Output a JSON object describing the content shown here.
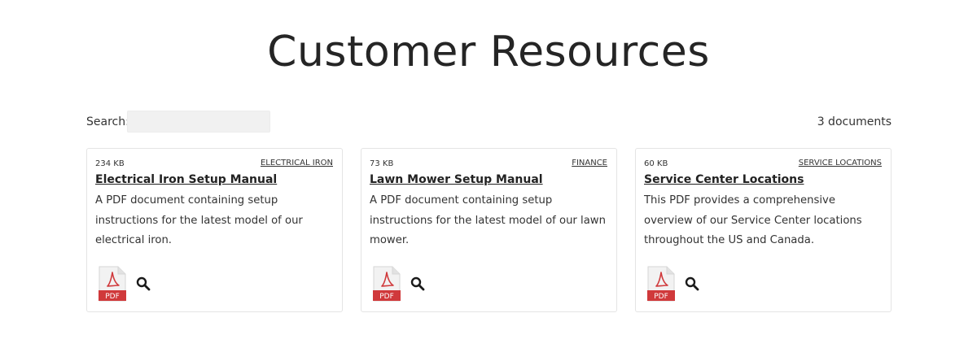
{
  "page": {
    "title": "Customer Resources"
  },
  "search": {
    "label": "Search:",
    "value": "",
    "placeholder": ""
  },
  "document_count": "3 documents",
  "documents": [
    {
      "size": "234 KB",
      "tag": "ELECTRICAL IRON",
      "title": "Electrical Iron Setup Manual",
      "description": "A PDF document containing setup instructions for the latest model of our electrical iron.",
      "file_icon": "pdf-file-icon",
      "file_icon_label": "PDF",
      "action_icon": "magnifier-icon"
    },
    {
      "size": "73 KB",
      "tag": "FINANCE",
      "title": "Lawn Mower Setup Manual",
      "description": "A PDF document containing setup instructions for the latest model of our lawn mower.",
      "file_icon": "pdf-file-icon",
      "file_icon_label": "PDF",
      "action_icon": "magnifier-icon"
    },
    {
      "size": "60 KB",
      "tag": "SERVICE LOCATIONS",
      "title": "Service Center Locations",
      "description": "This PDF provides a comprehensive overview of our Service Center locations throughout the US and Canada.",
      "file_icon": "pdf-file-icon",
      "file_icon_label": "PDF",
      "action_icon": "magnifier-icon"
    }
  ],
  "colors": {
    "pdf_red": "#d0393b",
    "text": "#222222",
    "card_border": "#e4e4e4",
    "search_bg": "#f1f1f1"
  }
}
